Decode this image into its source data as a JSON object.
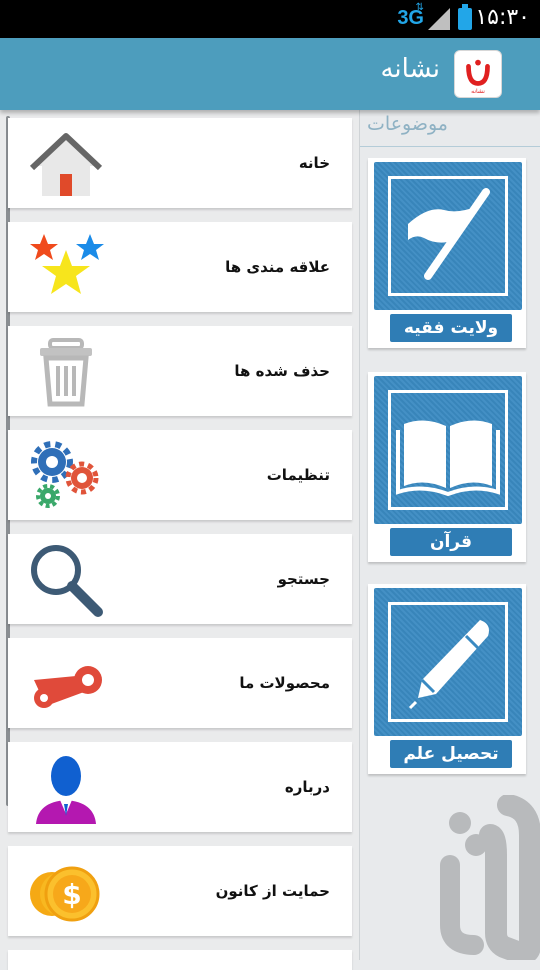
{
  "status_bar": {
    "time": "۱۵:۳۰",
    "network": "3G",
    "data_arrows": "⇅"
  },
  "header": {
    "title": "نشانه",
    "logo_text": "نشانه"
  },
  "drawer": {
    "items": [
      {
        "label": "خانه",
        "icon": "home-icon"
      },
      {
        "label": "علاقه مندی ها",
        "icon": "stars-icon"
      },
      {
        "label": "حذف شده ها",
        "icon": "trash-icon"
      },
      {
        "label": "تنظیمات",
        "icon": "gears-icon"
      },
      {
        "label": "جستجو",
        "icon": "search-icon"
      },
      {
        "label": "محصولات ما",
        "icon": "products-icon"
      },
      {
        "label": "درباره",
        "icon": "person-icon"
      },
      {
        "label": "حمایت از کانون",
        "icon": "coins-icon"
      }
    ]
  },
  "topics": {
    "title": "موضوعات",
    "cards": [
      {
        "label": "ولایت فقیه",
        "icon": "flag-icon"
      },
      {
        "label": "قرآن",
        "icon": "book-icon"
      },
      {
        "label": "تحصیل علم",
        "icon": "pen-icon"
      }
    ]
  },
  "colors": {
    "header": "#4d9dbd",
    "tile": "#3a8ac2",
    "tile_label": "#2f7db5",
    "accent": "#22a6e8"
  }
}
